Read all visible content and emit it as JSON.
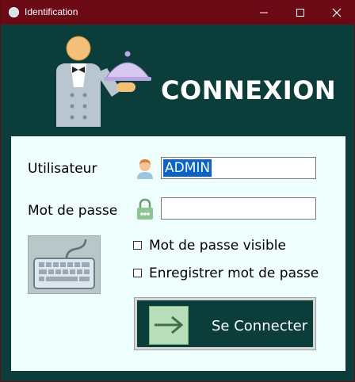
{
  "window": {
    "title": "Identification",
    "icon": "app-globe-icon"
  },
  "titlebar_controls": [
    "minimize-icon",
    "maximize-icon",
    "close-icon"
  ],
  "header": {
    "title": "CONNEXION",
    "illustration": "waiter-cloche-icon"
  },
  "form": {
    "user_label": "Utilisateur",
    "user_value": "ADMIN",
    "user_icon": "user-icon",
    "password_label": "Mot de passe",
    "password_value": "",
    "password_icon": "lock-icon",
    "show_password_label": "Mot de passe visible",
    "show_password_checked": false,
    "save_password_label": "Enregistrer mot de passe",
    "save_password_checked": false,
    "keyboard_icon": "keyboard-icon",
    "connect_label": "Se Connecter",
    "connect_icon": "arrow-right-icon"
  },
  "colors": {
    "background": "#0b3d3b",
    "titlebar": "#6b0a14",
    "panel": "#effffe",
    "selection": "#0a64c8",
    "arrow_box": "#b7ddb9"
  }
}
